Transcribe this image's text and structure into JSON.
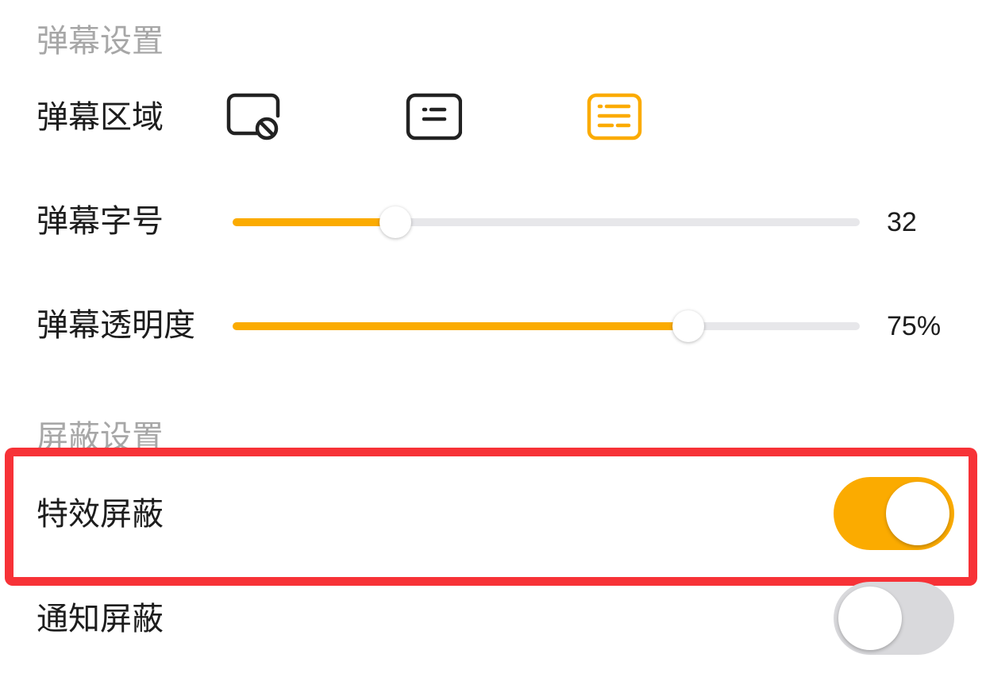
{
  "danmaku_settings": {
    "section_title": "弹幕设置",
    "area": {
      "label": "弹幕区域",
      "options": [
        {
          "icon": "danmaku-off-icon",
          "selected": false
        },
        {
          "icon": "danmaku-half-screen-icon",
          "selected": false
        },
        {
          "icon": "danmaku-full-screen-icon",
          "selected": true
        }
      ]
    },
    "font_size": {
      "label": "弹幕字号",
      "value_text": "32",
      "level": 0.26
    },
    "opacity": {
      "label": "弹幕透明度",
      "value_text": "75%",
      "level": 0.727
    }
  },
  "block_settings": {
    "section_title": "屏蔽设置",
    "effects_block": {
      "label": "特效屏蔽",
      "enabled": true
    },
    "notification_block": {
      "label": "通知屏蔽",
      "enabled": false
    }
  },
  "colors": {
    "accent": "#fbab00",
    "track": "#e7e7ea",
    "highlight": "#f73237",
    "icon_default": "#222222"
  }
}
